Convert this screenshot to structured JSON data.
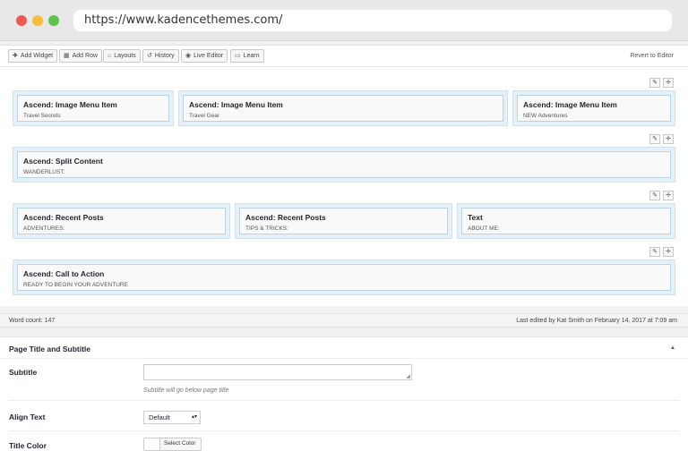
{
  "browser": {
    "url": "https://www.kadencethemes.com/"
  },
  "toolbar": {
    "add_widget": "Add Widget",
    "add_row": "Add Row",
    "layouts": "Layouts",
    "history": "History",
    "live_editor": "Live Editor",
    "learn": "Learn",
    "revert": "Revert to Editor"
  },
  "rows": [
    {
      "widgets": [
        {
          "title": "Ascend: Image Menu Item",
          "subtitle": "Travel Secrets"
        },
        {
          "title": "Ascend: Image Menu Item",
          "subtitle": "Travel Gear"
        },
        {
          "title": "Ascend: Image Menu Item",
          "subtitle": "NEW Adventures"
        }
      ]
    },
    {
      "widgets": [
        {
          "title": "Ascend: Split Content",
          "subtitle": "WANDERLUST:"
        }
      ]
    },
    {
      "widgets": [
        {
          "title": "Ascend: Recent Posts",
          "subtitle": "ADVENTURES:"
        },
        {
          "title": "Ascend: Recent Posts",
          "subtitle": "TIPS & TRICKS:"
        },
        {
          "title": "Text",
          "subtitle": "ABOUT ME:"
        }
      ]
    },
    {
      "widgets": [
        {
          "title": "Ascend: Call to Action",
          "subtitle": "READY TO BEGIN YOUR ADVENTURE"
        }
      ]
    }
  ],
  "status": {
    "word_count": "Word count: 147",
    "last_edited": "Last edited by Kat Smith on February 14, 2017 at 7:09 am"
  },
  "metabox": {
    "title": "Page Title and Subtitle",
    "subtitle_label": "Subtitle",
    "subtitle_hint": "Subtitle will go below page title",
    "align_label": "Align Text",
    "align_value": "Default",
    "color_label": "Title Color",
    "color_button": "Select Color"
  },
  "colors": {
    "cell_bg": "#e5f1f8",
    "widget_border": "#b8d3e2",
    "dot_red": "#ee5b52",
    "dot_yellow": "#f6be3a",
    "dot_green": "#5ec34b"
  },
  "icons": [
    "plus-icon",
    "grid-icon",
    "layouts-icon",
    "history-icon",
    "eye-icon",
    "learn-icon",
    "wrench-icon",
    "move-icon",
    "resize-icon",
    "collapse-arrow-icon",
    "dropdown-arrow-icon"
  ]
}
